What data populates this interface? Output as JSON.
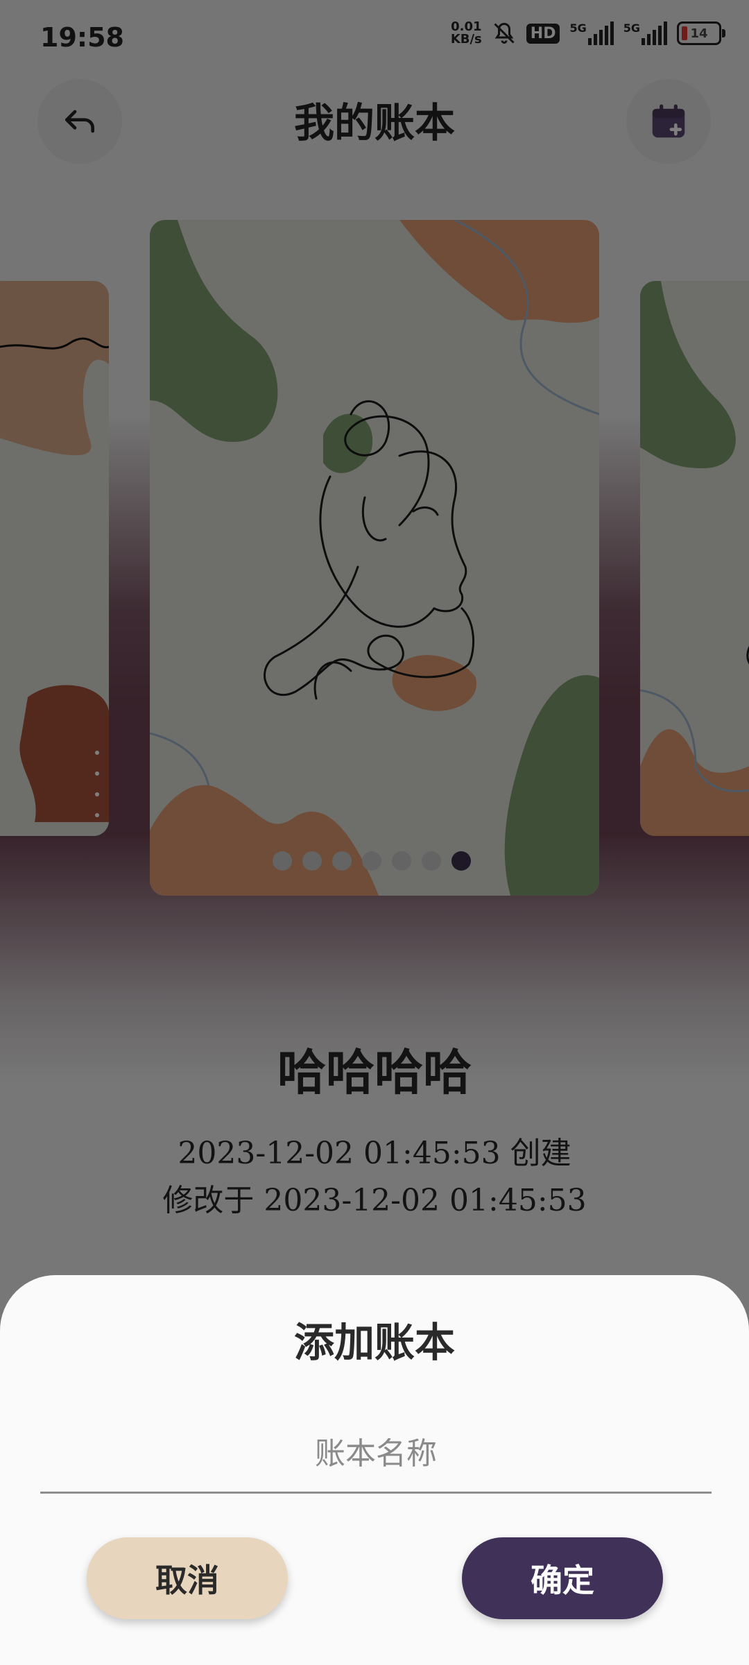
{
  "status_bar": {
    "time": "19:58",
    "net_speed_value": "0.01",
    "net_speed_unit": "KB/s",
    "hd_label": "HD",
    "signal_1_label": "5G",
    "signal_2_label": "5G",
    "battery_level": "14",
    "icons": [
      "bell-off-icon",
      "signal-icon",
      "signal-icon",
      "battery-icon"
    ]
  },
  "header": {
    "title": "我的账本",
    "back_icon": "back-arrow-icon",
    "calendar_icon": "calendar-add-icon"
  },
  "carousel": {
    "page_count": 7,
    "active_index": 6
  },
  "book": {
    "name": "哈哈哈哈",
    "created": "2023-12-02 01:45:53 创建",
    "modified": "修改于 2023-12-02 01:45:53"
  },
  "dialog": {
    "title": "添加账本",
    "input_placeholder": "账本名称",
    "input_value": "",
    "cancel_label": "取消",
    "confirm_label": "确定"
  },
  "colors": {
    "accent": "#3f3158",
    "cancel_bg": "#e8d5bd",
    "header_band": "#6e4354"
  }
}
